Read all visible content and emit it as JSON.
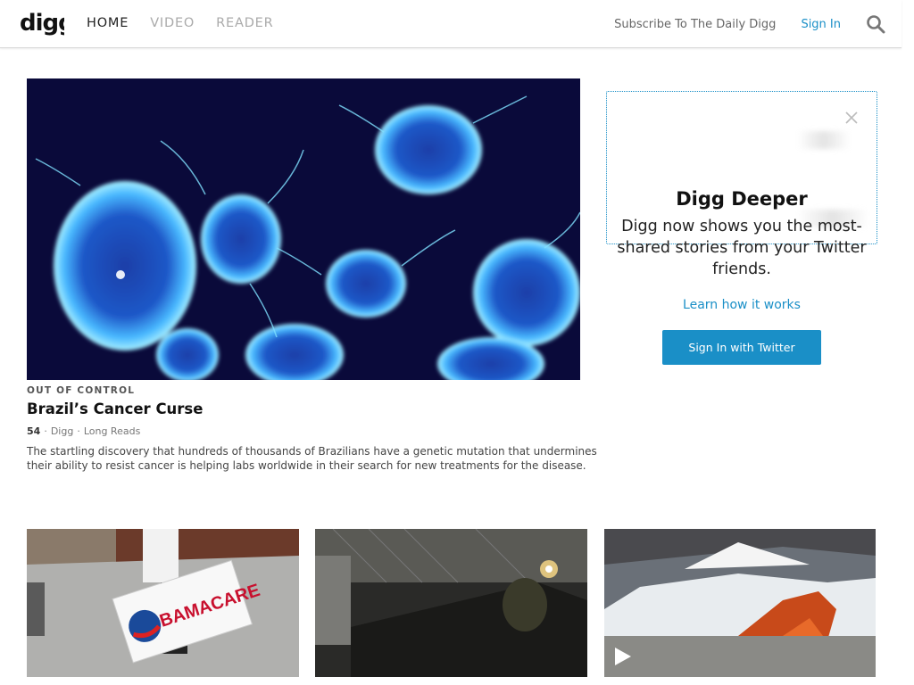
{
  "header": {
    "logo_text": "digg",
    "nav": [
      {
        "label": "HOME",
        "active": true
      },
      {
        "label": "VIDEO",
        "active": false
      },
      {
        "label": "READER",
        "active": false
      }
    ],
    "subscribe_label": "Subscribe To The Daily Digg",
    "signin_label": "Sign In",
    "search_icon": "search-icon"
  },
  "hero": {
    "kicker": "OUT OF CONTROL",
    "title": "Brazil’s Cancer Curse",
    "digg_count": "54",
    "source": "Digg",
    "category": "Long Reads",
    "description": "The startling discovery that hundreds of thousands of Brazilians have a genetic mutation that undermines their ability to resist cancer is helping labs worldwide in their search for new treatments for the disease."
  },
  "sidebar": {
    "title": "Digg Deeper",
    "description": "Digg now shows you the most-shared stories from your Twitter friends.",
    "learn_link": "Learn how it works",
    "button_label": "Sign In with Twitter"
  },
  "thumbnails": [
    {
      "sign_text": "BAMACARE"
    },
    {},
    {
      "icon": "play-icon"
    }
  ],
  "colors": {
    "accent": "#1a8fc7",
    "hero_bg": "#0a0a3a"
  }
}
